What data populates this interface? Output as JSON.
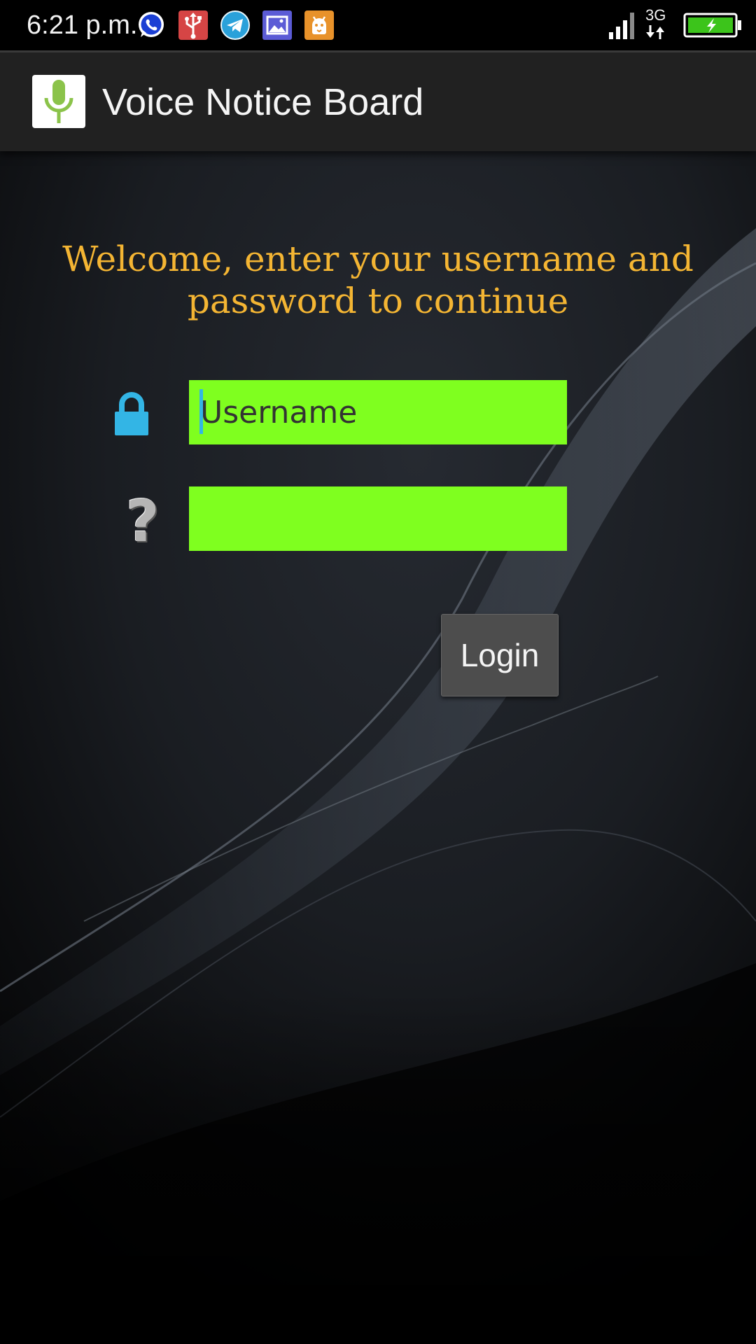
{
  "status_bar": {
    "time": "6:21 p.m.",
    "network": "3G",
    "notification_icons": [
      "whatsapp-icon",
      "usb-icon",
      "telegram-icon",
      "gallery-icon",
      "android-icon"
    ],
    "indicators": [
      "signal-icon",
      "data-arrows-icon",
      "battery-charging-icon"
    ]
  },
  "action_bar": {
    "title": "Voice Notice Board",
    "app_icon": "microphone-icon"
  },
  "login": {
    "welcome_text": "Welcome, enter your username and password to continue",
    "username_icon": "lock-icon",
    "username_placeholder": "Username",
    "username_value": "",
    "password_icon": "question-mark-icon",
    "password_value": "",
    "login_label": "Login"
  },
  "colors": {
    "status_bar_bg": "#000000",
    "action_bar_bg": "#212121",
    "welcome_text": "#f4b533",
    "field_bg": "#7fff1f",
    "lock_icon": "#33b5e5",
    "login_button_bg": "#4d4d4d",
    "battery_fill": "#3cc41b"
  }
}
